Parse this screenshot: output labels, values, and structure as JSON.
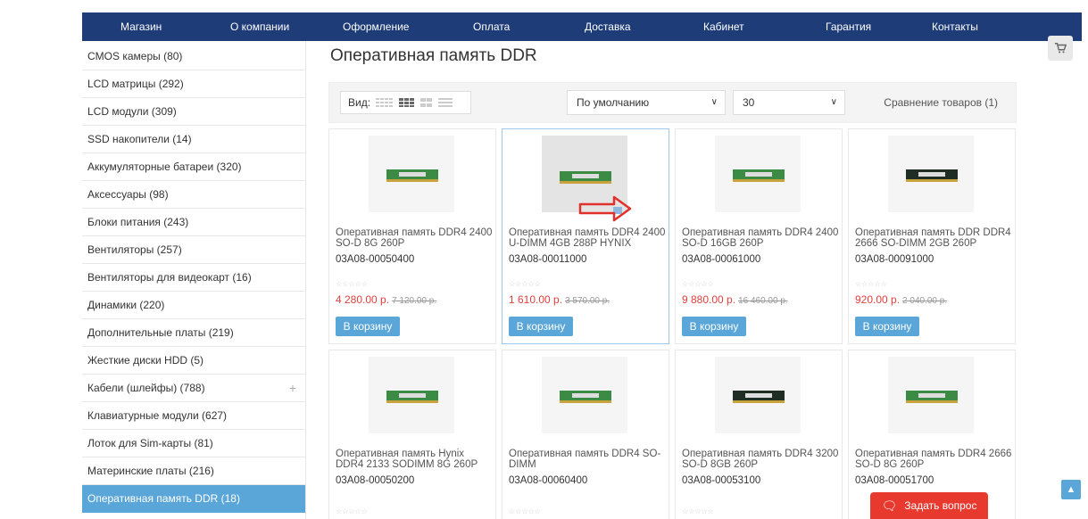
{
  "nav": {
    "items": [
      "Магазин",
      "О компании",
      "Оформление",
      "Оплата",
      "Доставка",
      "Кабинет",
      "Гарантия",
      "Контакты"
    ]
  },
  "sidebar": {
    "categories": [
      {
        "label": "CMOS камеры (80)"
      },
      {
        "label": "LCD матрицы (292)"
      },
      {
        "label": "LCD модули (309)"
      },
      {
        "label": "SSD накопители (14)"
      },
      {
        "label": "Аккумуляторные батареи (320)"
      },
      {
        "label": "Аксессуары (98)"
      },
      {
        "label": "Блоки питания (243)"
      },
      {
        "label": "Вентиляторы (257)"
      },
      {
        "label": "Вентиляторы для видеокарт (16)"
      },
      {
        "label": "Динамики (220)"
      },
      {
        "label": "Дополнительные платы (219)"
      },
      {
        "label": "Жесткие диски HDD (5)"
      },
      {
        "label": "Кабели (шлейфы) (788)",
        "expand": "+"
      },
      {
        "label": "Клавиатурные модули (627)"
      },
      {
        "label": "Лоток для Sim-карты (81)"
      },
      {
        "label": "Материнские платы (216)"
      },
      {
        "label": "Оперативная память DDR (18)",
        "active": true
      }
    ]
  },
  "main": {
    "title": "Оперативная память DDR",
    "toolbar": {
      "view_label": "Вид:",
      "sort_value": "По умолчанию",
      "per_page_value": "30",
      "compare_label": "Сравнение товаров (1)"
    },
    "products": [
      {
        "name": "Оперативная память DDR4 2400 SO-D 8G 260P",
        "sku": "03A08-00050400",
        "price": "4 280.00 р.",
        "old_price": "7 120.00 р.",
        "buy": "В корзину"
      },
      {
        "name": "Оперативная память DDR4 2400 U-DIMM 4GB 288P HYNIX",
        "sku": "03A08-00011000",
        "price": "1 610.00 р.",
        "old_price": "3 570.00 р.",
        "buy": "В корзину"
      },
      {
        "name": "Оперативная память DDR4 2400 SO-D 16GB 260P",
        "sku": "03A08-00061000",
        "price": "9 880.00 р.",
        "old_price": "16 460.00 р.",
        "buy": "В корзину"
      },
      {
        "name": "Оперативная память DDR DDR4 2666 SO-DIMM 2GB 260P",
        "sku": "03A08-00091000",
        "price": "920.00 р.",
        "old_price": "2 040.00 р.",
        "buy": "В корзину"
      },
      {
        "name": "Оперативная память Hynix DDR4 2133 SODIMM 8G 260P",
        "sku": "03A08-00050200"
      },
      {
        "name": "Оперативная память DDR4 SO-DIMM",
        "sku": "03A08-00060400"
      },
      {
        "name": "Оперативная память DDR4 3200 SO-D 8GB 260P",
        "sku": "03A08-00053100"
      },
      {
        "name": "Оперативная память DDR4 2666 SO-D 8G 260P",
        "sku": "03A08-00051700"
      }
    ],
    "stars": "☆☆☆☆☆"
  },
  "widgets": {
    "ask_label": "Задать вопрос"
  },
  "colors": {
    "nav_bg": "#1e3c78",
    "accent": "#5aa6d8",
    "price": "#e1403c",
    "ask_bg": "#e8392f"
  }
}
